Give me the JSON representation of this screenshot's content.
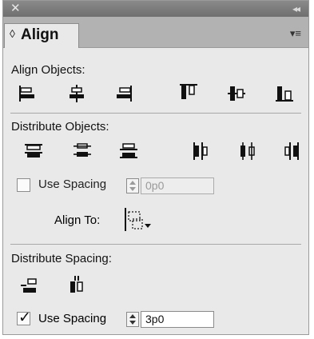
{
  "panel": {
    "title": "Align",
    "tab_arrows": "◊",
    "close_glyph": "✕",
    "collapse_glyph": "◂◂",
    "menu_glyph": "▾≡"
  },
  "align_objects": {
    "label": "Align Objects:",
    "buttons": [
      "align-left-edges",
      "align-horizontal-centers",
      "align-right-edges",
      "align-top-edges",
      "align-vertical-centers",
      "align-bottom-edges"
    ]
  },
  "distribute_objects": {
    "label": "Distribute Objects:",
    "buttons": [
      "distribute-top-edges",
      "distribute-vertical-centers",
      "distribute-bottom-edges",
      "distribute-left-edges",
      "distribute-horizontal-centers",
      "distribute-right-edges"
    ],
    "use_spacing_label": "Use Spacing",
    "use_spacing_checked": false,
    "spacing_value": "0p0",
    "align_to_label": "Align To:"
  },
  "distribute_spacing": {
    "label": "Distribute Spacing:",
    "use_spacing_label": "Use Spacing",
    "use_spacing_checked": true,
    "spacing_value": "3p0",
    "checkmark": "✓"
  }
}
